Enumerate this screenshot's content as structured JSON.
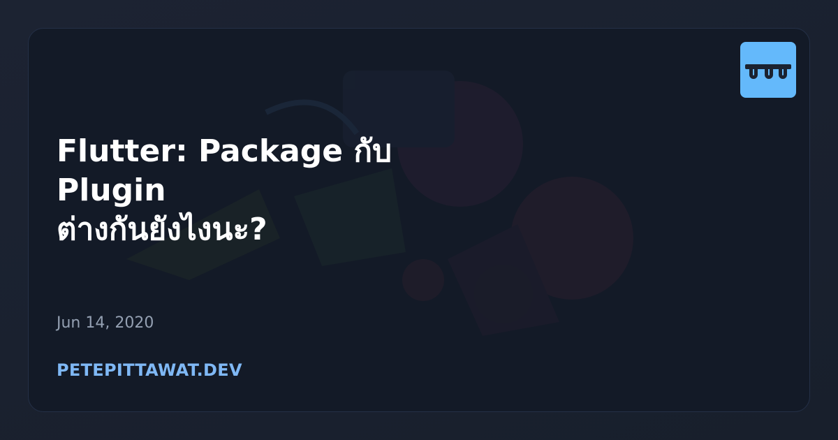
{
  "title_lines": [
    "Flutter: Package กับ",
    "Plugin",
    "ต่างกันยังไงนะ?"
  ],
  "date": "Jun 14, 2020",
  "site": "PETEPITTAWAT.DEV",
  "logo": {
    "icon": "eyes-logo-icon",
    "background": "#64b9fb"
  },
  "colors": {
    "page_bg": "#1a2130",
    "card_bg": "#131a27",
    "title": "#ffffff",
    "date": "#94a0b2",
    "site": "#7fb8f5"
  }
}
